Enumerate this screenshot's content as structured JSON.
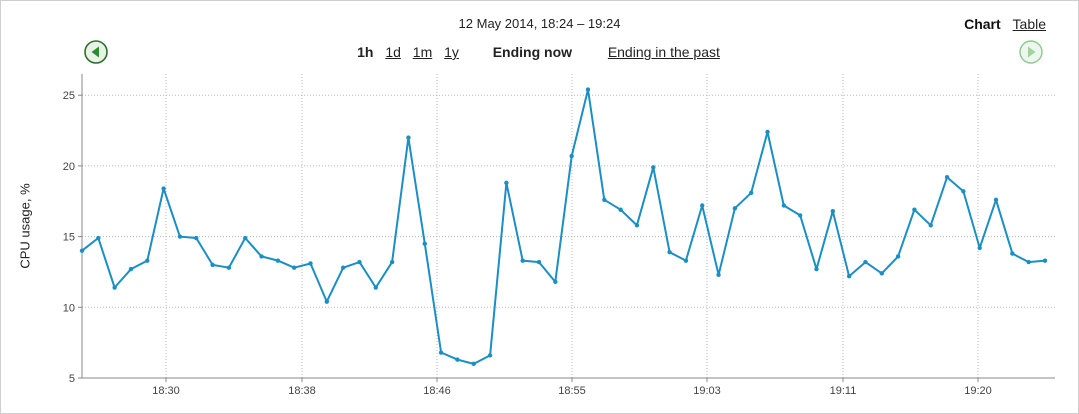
{
  "header": {
    "period_title": "12 May 2014, 18:24 – 19:24",
    "view_chart": "Chart",
    "view_table": "Table"
  },
  "range": {
    "spans": [
      {
        "label": "1h",
        "active": true
      },
      {
        "label": "1d",
        "active": false
      },
      {
        "label": "1m",
        "active": false
      },
      {
        "label": "1y",
        "active": false
      }
    ],
    "ending_now": "Ending now",
    "ending_past": "Ending in the past"
  },
  "nav": {
    "prev_icon": "arrow-left-circle-icon",
    "next_icon": "arrow-right-circle-icon",
    "prev_color": "#3a8f3a",
    "next_color": "#9fd49f"
  },
  "chart_data": {
    "type": "line",
    "title": "",
    "xlabel": "",
    "ylabel": "CPU usage, %",
    "ylim": [
      5,
      26.5
    ],
    "yticks": [
      5,
      10,
      15,
      20,
      25
    ],
    "xticks": [
      "18:30",
      "18:38",
      "18:46",
      "18:55",
      "19:03",
      "19:11",
      "19:20"
    ],
    "grid": true,
    "line_color": "#1a8fc4",
    "series": [
      {
        "values": [
          14.0,
          14.9,
          11.4,
          12.7,
          13.3,
          18.4,
          15.0,
          14.9,
          13.0,
          12.8,
          14.9,
          13.6,
          13.3,
          12.8,
          13.1,
          10.4,
          12.8,
          13.2,
          11.4,
          13.2,
          22.0,
          14.5,
          6.8,
          6.3,
          6.0,
          6.6,
          18.8,
          13.3,
          13.2,
          11.8,
          20.7,
          25.4,
          17.6,
          16.9,
          15.8,
          19.9,
          13.9,
          13.3,
          17.2,
          12.3,
          17.0,
          18.1,
          22.4,
          17.2,
          16.5,
          12.7,
          16.8,
          12.2,
          13.2,
          12.4,
          13.6,
          16.9,
          15.8,
          19.2,
          18.2,
          14.2,
          17.6,
          13.8,
          13.2,
          13.3
        ]
      }
    ]
  }
}
